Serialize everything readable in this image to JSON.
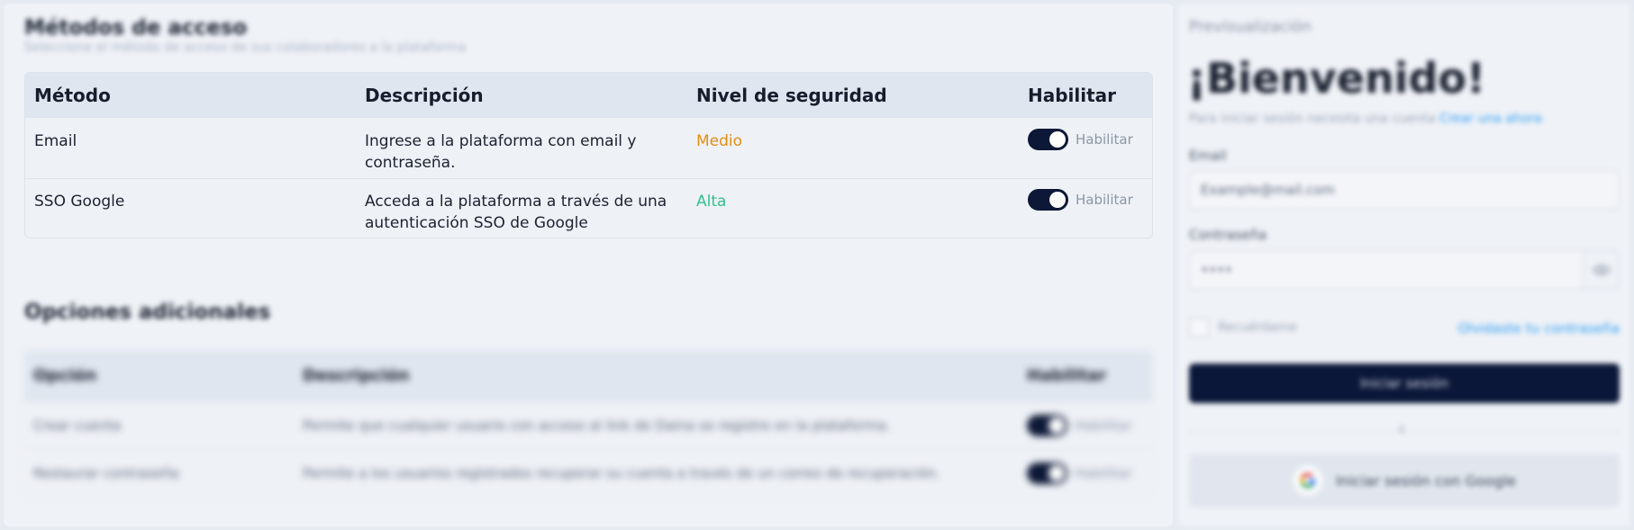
{
  "access_methods": {
    "title": "Métodos de acceso",
    "subtitle": "Seleccione el método de acceso de sus colaboradores a la plataforma",
    "headers": {
      "method": "Método",
      "description": "Descripción",
      "security": "Nivel de seguridad",
      "enable": "Habilitar"
    },
    "rows": [
      {
        "method": "Email",
        "description_line1": "Ingrese a la plataforma con email y",
        "description_line2": "contraseña.",
        "security": "Medio",
        "enabled": true,
        "toggle_label": "Habilitar"
      },
      {
        "method": "SSO Google",
        "description_line1": "Acceda a la plataforma a través de una",
        "description_line2": "autenticación SSO de Google",
        "security": "Alta",
        "enabled": true,
        "toggle_label": "Habilitar"
      }
    ]
  },
  "additional_options": {
    "title": "Opciones adicionales",
    "headers": {
      "option": "Opción",
      "description": "Descripción",
      "enable": "Habilitar"
    },
    "rows": [
      {
        "option": "Crear cuenta",
        "description": "Permite que cualquier usuario con acceso al link de Daina se registre en la plataforma.",
        "enabled": true,
        "toggle_label": "Habilitar"
      },
      {
        "option": "Restaurar contraseña",
        "description": "Permite a los usuarios registrados recuperar su cuenta a través de un correo de recuperación.",
        "enabled": true,
        "toggle_label": "Habilitar"
      }
    ]
  },
  "preview": {
    "label": "Previsualización",
    "welcome": "¡Bienvenido!",
    "signup_prompt": "Para iniciar sesión necesita una cuenta",
    "signup_link": "Crear una ahora",
    "email_label": "Email",
    "email_placeholder": "Example@mail.com",
    "password_label": "Contraseña",
    "password_value": "••••",
    "remember_label": "Recuérdame",
    "forgot_link": "Olvidaste tu contraseña",
    "login_button": "Iniciar sesión",
    "divider_text": "o",
    "google_button": "Iniciar sesión con Google",
    "icons": {
      "eye": "eye-icon",
      "google": "google-icon"
    }
  },
  "colors": {
    "toggle_on": "#0d1736",
    "security_medium": "#e48e12",
    "security_high": "#35c08e",
    "link": "#2d9bf0",
    "primary_button": "#0b1738"
  }
}
